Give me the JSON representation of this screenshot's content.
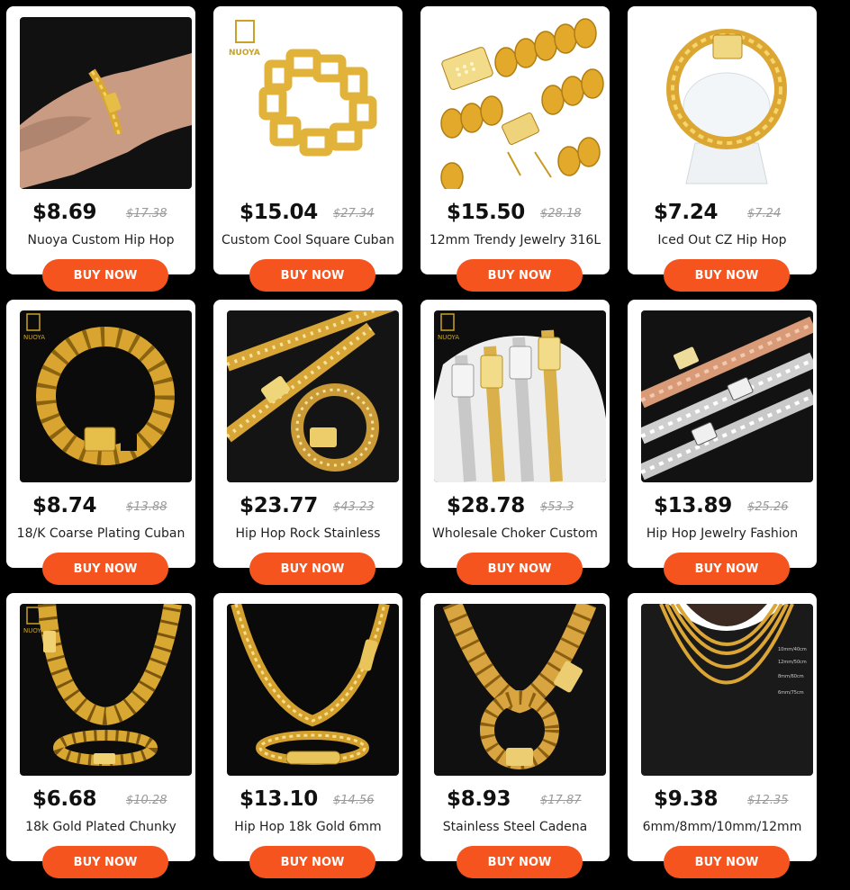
{
  "products": [
    {
      "price": "$8.69",
      "old_price": "$17.38",
      "title": "Nuoya Custom Hip Hop",
      "button": "BUY NOW",
      "image": "bracelet-on-wrist"
    },
    {
      "price": "$15.04",
      "old_price": "$27.34",
      "title": "Custom Cool Square Cuban",
      "button": "BUY NOW",
      "image": "square-link-bracelet",
      "logo": "NUOYA"
    },
    {
      "price": "$15.50",
      "old_price": "$28.18",
      "title": "12mm Trendy Jewelry 316L",
      "button": "BUY NOW",
      "image": "iced-clasp-chain"
    },
    {
      "price": "$7.24",
      "old_price": "$7.24",
      "title": "Iced Out CZ Hip Hop",
      "button": "BUY NOW",
      "image": "bracelet-on-stand"
    },
    {
      "price": "$8.74",
      "old_price": "$13.88",
      "title": "18/K Coarse Plating Cuban",
      "button": "BUY NOW",
      "image": "cuban-bracelet-black",
      "logo": "NUOYA"
    },
    {
      "price": "$23.77",
      "old_price": "$43.23",
      "title": "Hip Hop Rock Stainless",
      "button": "BUY NOW",
      "image": "iced-cuban-set"
    },
    {
      "price": "$28.78",
      "old_price": "$53.3",
      "title": "Wholesale Choker Custom",
      "button": "BUY NOW",
      "image": "silver-gold-chokers",
      "logo": "NUOYA"
    },
    {
      "price": "$13.89",
      "old_price": "$25.26",
      "title": "Hip Hop Jewelry Fashion",
      "button": "BUY NOW",
      "image": "tricolor-chains"
    },
    {
      "price": "$6.68",
      "old_price": "$10.28",
      "title": "18k Gold Plated Chunky",
      "button": "BUY NOW",
      "image": "chunky-chain-bracelet",
      "logo": "NUOYA"
    },
    {
      "price": "$13.10",
      "old_price": "$14.56",
      "title": "Hip Hop 18k Gold 6mm",
      "button": "BUY NOW",
      "image": "wheat-chain-set"
    },
    {
      "price": "$8.93",
      "old_price": "$17.87",
      "title": "Stainless Steel Cadena",
      "button": "BUY NOW",
      "image": "cadena-chain-set"
    },
    {
      "price": "$9.38",
      "old_price": "$12.35",
      "title": "6mm/8mm/10mm/12mm",
      "button": "BUY NOW",
      "image": "layered-necklaces",
      "size_labels": [
        "10mm/40cm",
        "12mm/50cm",
        "8mm/60cm",
        "6mm/75cm"
      ]
    }
  ],
  "colors": {
    "background": "#000000",
    "card": "#ffffff",
    "button": "#f5541f",
    "price": "#111111",
    "old_price": "#9a9a9a",
    "gold": "#e2b33a"
  }
}
